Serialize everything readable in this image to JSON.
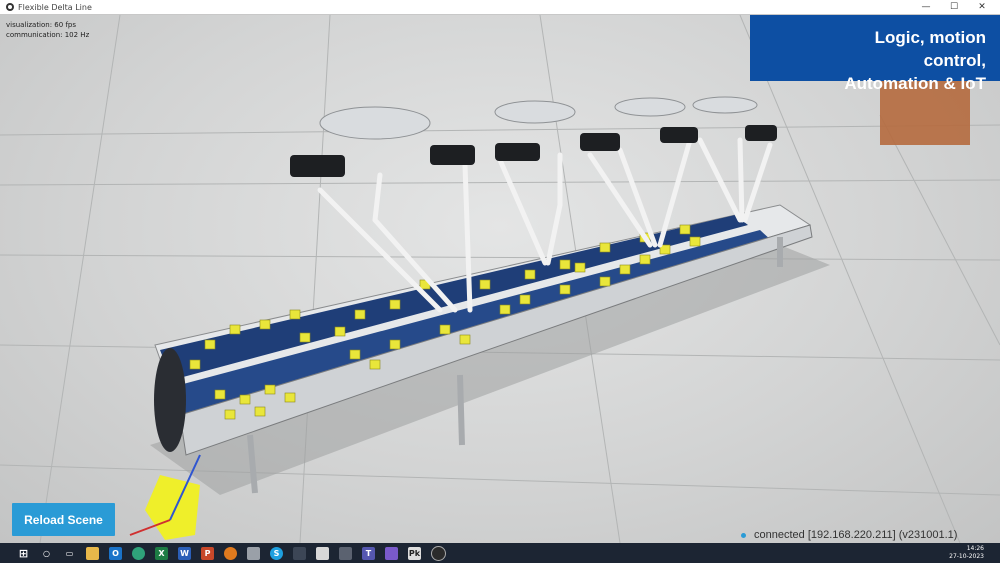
{
  "window": {
    "title": "Flexible Delta Line",
    "controls": [
      "—",
      "☐",
      "✕"
    ]
  },
  "stats": {
    "visualization": "visualization: 60 fps",
    "communication": "communication: 102 Hz"
  },
  "banner": {
    "line1": "Logic, motion control,",
    "line2": "Automation & IoT",
    "color": "#0d4fa3"
  },
  "reload_button": {
    "label": "Reload Scene",
    "color": "#2a9bd6"
  },
  "status": {
    "text": "connected [192.168.220.211] (v231001.1)",
    "dot_color": "#2a9bd6"
  },
  "taskbar": {
    "icons": [
      "windows-icon",
      "search-icon",
      "task-view-icon",
      "file-explorer-icon",
      "outlook-icon",
      "edge-icon",
      "excel-icon",
      "word-icon",
      "powerpoint-icon",
      "search-app-icon",
      "snipping-icon",
      "skype-icon",
      "media-icon",
      "unity-icon",
      "calculator-icon",
      "teams-icon",
      "paint-icon",
      "vs-icon",
      "obs-icon"
    ],
    "time": "14:26",
    "date": "27-10-2023"
  }
}
